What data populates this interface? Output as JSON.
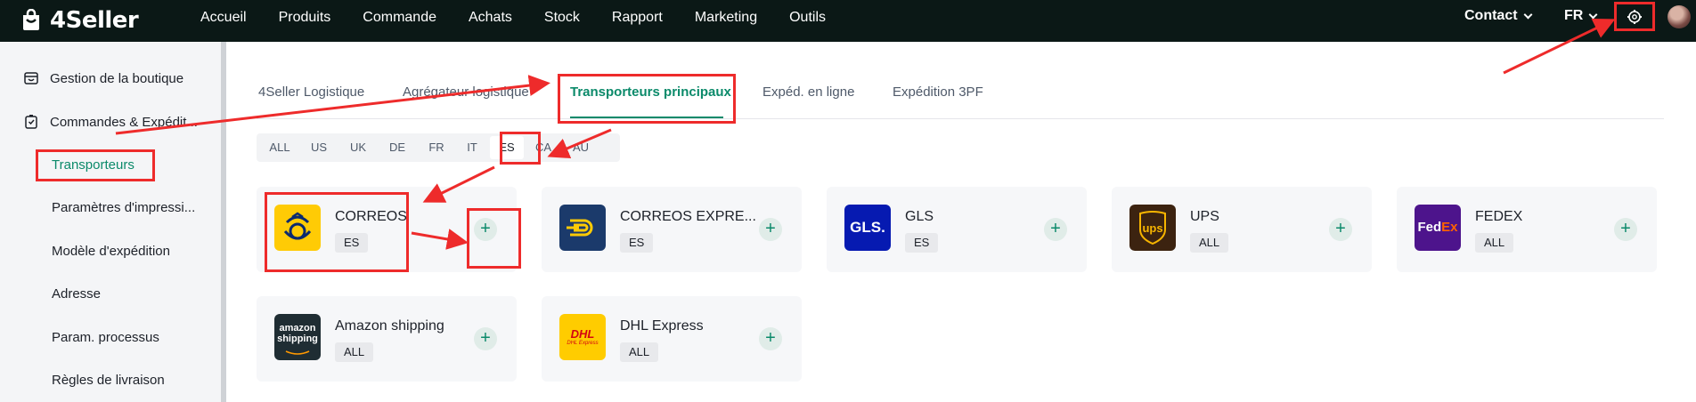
{
  "app": {
    "logo_text": "4Seller"
  },
  "nav": {
    "items": [
      "Accueil",
      "Produits",
      "Commande",
      "Achats",
      "Stock",
      "Rapport",
      "Marketing",
      "Outils"
    ]
  },
  "header": {
    "contact_label": "Contact",
    "lang_label": "FR"
  },
  "sidebar": {
    "groups": [
      {
        "label": "Gestion de la boutique",
        "icon": "shop-icon"
      },
      {
        "label": "Commandes & Expédit...",
        "icon": "orders-icon"
      }
    ],
    "items": [
      "Transporteurs",
      "Paramètres d'impressi...",
      "Modèle d'expédition",
      "Adresse",
      "Param. processus",
      "Règles de livraison"
    ]
  },
  "tabs": [
    "4Seller Logistique",
    "Agrégateur logistique",
    "Transporteurs principaux",
    "Expéd. en ligne",
    "Expédition 3PF"
  ],
  "countries": [
    "ALL",
    "US",
    "UK",
    "DE",
    "FR",
    "IT",
    "ES",
    "CA",
    "AU"
  ],
  "carriers": [
    {
      "name": "CORREOS",
      "badge": "ES"
    },
    {
      "name": "CORREOS EXPRE...",
      "badge": "ES"
    },
    {
      "name": "GLS",
      "badge": "ES"
    },
    {
      "name": "UPS",
      "badge": "ALL"
    },
    {
      "name": "FEDEX",
      "badge": "ALL"
    },
    {
      "name": "Amazon shipping",
      "badge": "ALL"
    },
    {
      "name": "DHL Express",
      "badge": "ALL"
    }
  ],
  "logos": {
    "gls": "GLS.",
    "ups": "ups",
    "fedex_fed": "Fed",
    "fedex_ex": "Ex",
    "amazon_line1": "amazon",
    "amazon_line2": "shipping",
    "dhl_main": "DHL",
    "dhl_sub": "DHL Express"
  },
  "add_label": "+",
  "colors": {
    "accent": "#0b8a6a",
    "topbar": "#0b1816",
    "annotation": "#ee2b2b"
  }
}
